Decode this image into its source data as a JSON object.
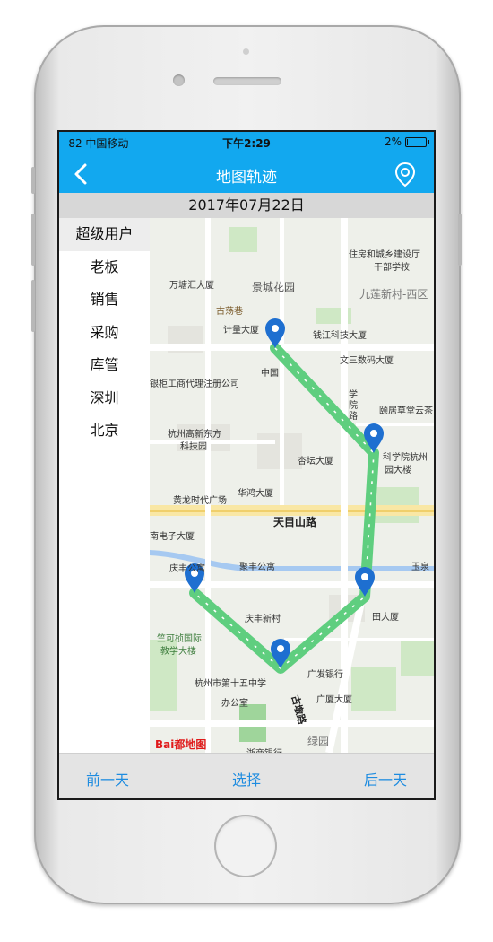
{
  "status": {
    "signal": "-82 中国移动",
    "time": "下午2:29",
    "battery_text": "2%",
    "battery_level": 0.04
  },
  "nav": {
    "title": "地图轨迹",
    "back_icon": "chevron-left-icon",
    "right_icon": "location-pin-icon"
  },
  "date": "2017年07月22日",
  "sidebar": {
    "items": [
      {
        "label": "超级用户",
        "active": true
      },
      {
        "label": "老板"
      },
      {
        "label": "销售"
      },
      {
        "label": "采购"
      },
      {
        "label": "库管"
      },
      {
        "label": "深圳"
      },
      {
        "label": "北京"
      }
    ]
  },
  "map": {
    "labels": [
      {
        "id": "wantang",
        "text": "万塘汇大厦"
      },
      {
        "id": "jingcheng",
        "text": "景城花园"
      },
      {
        "id": "zhufang",
        "text": "住房和城乡建设厅"
      },
      {
        "id": "ganbu",
        "text": "干部学校"
      },
      {
        "id": "jiulian",
        "text": "九莲新村-西区"
      },
      {
        "id": "gudang",
        "text": "古荡巷"
      },
      {
        "id": "jiliang",
        "text": "计量大厦"
      },
      {
        "id": "qianjiang",
        "text": "钱江科技大厦"
      },
      {
        "id": "wensan",
        "text": "文三数码大厦"
      },
      {
        "id": "zhongyin",
        "text": "中国"
      },
      {
        "id": "yingui",
        "text": "银柜工商代理注册公司"
      },
      {
        "id": "xueyuan",
        "text": "学院路"
      },
      {
        "id": "yiqing",
        "text": "颐居草堂云茶"
      },
      {
        "id": "gaoxin",
        "text": "杭州高新东方"
      },
      {
        "id": "kejiyuan",
        "text": "科技园"
      },
      {
        "id": "xingtan",
        "text": "杏坛大厦"
      },
      {
        "id": "kexueyuan",
        "text": "科学院杭州"
      },
      {
        "id": "yuandalou",
        "text": "园大楼"
      },
      {
        "id": "huanglong",
        "text": "黄龙时代广场"
      },
      {
        "id": "huahong",
        "text": "华鸿大厦"
      },
      {
        "id": "nandianzi",
        "text": "南电子大厦"
      },
      {
        "id": "qingfenggongyu",
        "text": "庆丰公寓"
      },
      {
        "id": "jufeng",
        "text": "聚丰公寓"
      },
      {
        "id": "yuquan",
        "text": "玉泉"
      },
      {
        "id": "tiandasha",
        "text": "田大厦"
      },
      {
        "id": "qingfengxincun",
        "text": "庆丰新村"
      },
      {
        "id": "zhukezhen",
        "text": "竺可桢国际"
      },
      {
        "id": "jiaoxue",
        "text": "教学大楼"
      },
      {
        "id": "shiwuzhong",
        "text": "杭州市第十五中学"
      },
      {
        "id": "guangfa",
        "text": "广发银行"
      },
      {
        "id": "bangongshi",
        "text": "办公室"
      },
      {
        "id": "guangsha",
        "text": "广厦大厦"
      },
      {
        "id": "lvyuan",
        "text": "绿园"
      },
      {
        "id": "zheshang",
        "text": "浙商银行"
      }
    ],
    "roads": {
      "tianmushan": "天目山路",
      "gudun": "古墩路"
    },
    "logo": "Bai都地图"
  },
  "bottom": {
    "prev": "前一天",
    "select": "选择",
    "next": "后一天"
  },
  "colors": {
    "accent": "#12a8ef",
    "route": "#5fce7f",
    "pin": "#1e6fd0",
    "link": "#1e8ce0"
  }
}
